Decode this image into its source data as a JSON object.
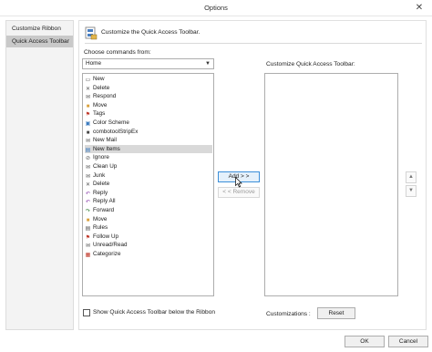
{
  "window": {
    "title": "Options",
    "close_glyph": "✕"
  },
  "nav": {
    "items": [
      {
        "label": "Customize Ribbon",
        "selected": false
      },
      {
        "label": "Quick Access Toolbar",
        "selected": true
      }
    ]
  },
  "header": {
    "text": "Customize the Quick Access Toolbar."
  },
  "choose": {
    "label": "Choose commands from:",
    "selected_value": "Home",
    "items": [
      {
        "label": "New",
        "icon": "new-icon"
      },
      {
        "label": "Delete",
        "icon": "delete-icon"
      },
      {
        "label": "Respond",
        "icon": "respond-icon"
      },
      {
        "label": "Move",
        "icon": "folder-icon"
      },
      {
        "label": "Tags",
        "icon": "flag-icon"
      },
      {
        "label": "Color Scheme",
        "icon": "color-scheme-icon"
      },
      {
        "label": "combotoolStripEx",
        "icon": "combo-icon"
      },
      {
        "label": "New Mail",
        "icon": "mail-icon"
      },
      {
        "label": "New Items",
        "icon": "new-items-icon",
        "selected": true
      },
      {
        "label": "Ignore",
        "icon": "ignore-icon"
      },
      {
        "label": "Clean Up",
        "icon": "clean-up-icon"
      },
      {
        "label": "Junk",
        "icon": "junk-icon"
      },
      {
        "label": "Delete",
        "icon": "delete-icon"
      },
      {
        "label": "Reply",
        "icon": "reply-icon"
      },
      {
        "label": "Reply All",
        "icon": "reply-all-icon"
      },
      {
        "label": "Forward",
        "icon": "forward-icon"
      },
      {
        "label": "Move",
        "icon": "folder-icon"
      },
      {
        "label": "Rules",
        "icon": "rules-icon"
      },
      {
        "label": "Follow Up",
        "icon": "flag-icon"
      },
      {
        "label": "Unread/Read",
        "icon": "unread-icon"
      },
      {
        "label": "Categorize",
        "icon": "categorize-icon"
      }
    ]
  },
  "qat": {
    "label": "Customize Quick Access Toolbar:"
  },
  "buttons": {
    "add": "Add > >",
    "remove": "< < Remove",
    "move_up": "▲",
    "move_down": "▼",
    "reset": "Reset",
    "ok": "OK",
    "cancel": "Cancel"
  },
  "show_below": {
    "label": "Show Quick Access Toolbar below the Ribbon",
    "checked": false
  },
  "customizations": {
    "label": "Customizations :"
  },
  "colors": {
    "selection": "#d9d9d9",
    "nav_selected": "#c9c9c9",
    "accent": "#3c8fd9"
  }
}
